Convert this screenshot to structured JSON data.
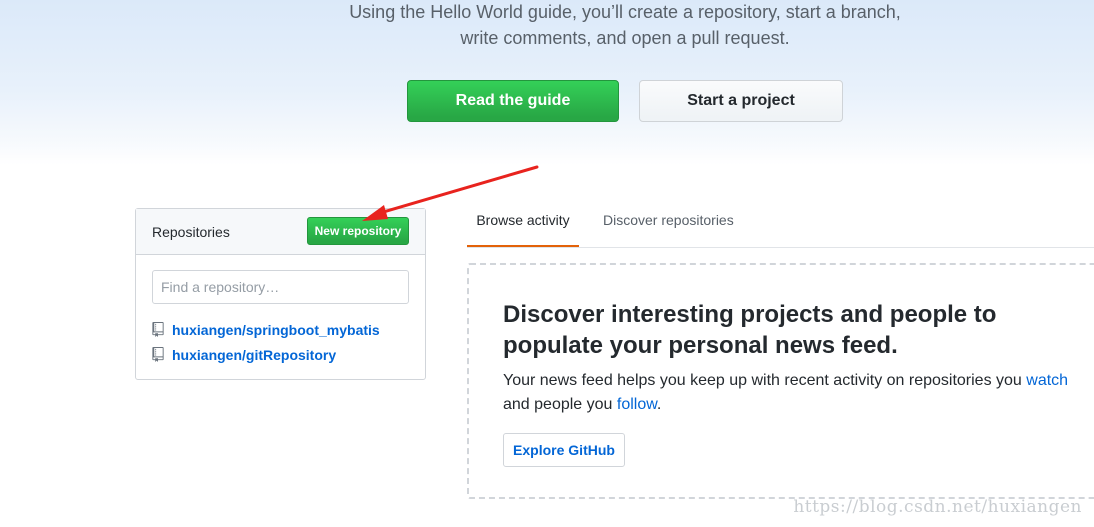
{
  "hero": {
    "line1": "Using the Hello World guide, you’ll create a repository, start a branch,",
    "line2": "write comments, and open a pull request.",
    "read_guide_label": "Read the guide",
    "start_project_label": "Start a project"
  },
  "repositories": {
    "title": "Repositories",
    "new_button_label": "New repository",
    "search_placeholder": "Find a repository…",
    "items": [
      {
        "name": "huxiangen/springboot_mybatis",
        "icon": "repo-icon"
      },
      {
        "name": "huxiangen/gitRepository",
        "icon": "repo-icon"
      }
    ]
  },
  "tabs": {
    "browse_activity": "Browse activity",
    "discover_repositories": "Discover repositories",
    "active": "browse_activity"
  },
  "feed": {
    "heading": "Discover interesting projects and people to populate your personal news feed.",
    "text_prefix": "Your news feed helps you keep up with recent activity on repositories you ",
    "watch_link": "watch",
    "text_middle": " and people you ",
    "follow_link": "follow",
    "text_suffix": ".",
    "explore_button_label": "Explore GitHub"
  },
  "annotation": {
    "arrow_color": "#e8231e",
    "arrow_target": "new-repository-button"
  },
  "watermark": "https://blog.csdn.net/huxiangen",
  "colors": {
    "primary_green": "#28a745",
    "link_blue": "#0366d6",
    "active_tab_underline": "#e36209"
  }
}
